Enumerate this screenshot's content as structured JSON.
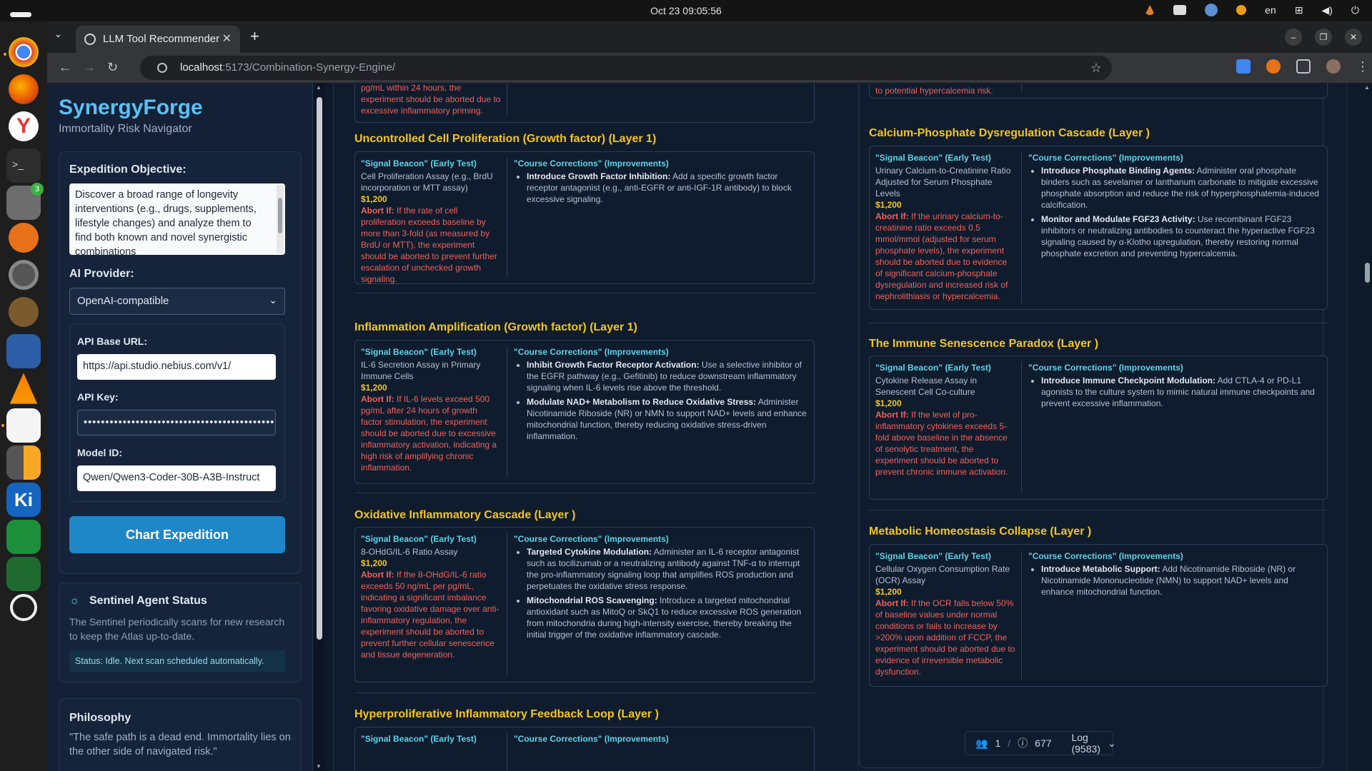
{
  "os": {
    "clock": "Oct 23  09:05:56",
    "lang": "en"
  },
  "dock": {
    "files_badge": "3"
  },
  "browser": {
    "tab_title": "LLM Tool Recommender",
    "url_host": "localhost",
    "url_path": ":5173/Combination-Synergy-Engine/"
  },
  "sidebar": {
    "brand": "SynergyForge",
    "subtitle": "Immortality Risk Navigator",
    "objective_label": "Expedition Objective:",
    "objective_text": "Discover a broad range of longevity interventions (e.g., drugs, supplements, lifestyle changes) and analyze them to find both known and novel synergistic combinations",
    "provider_label": "AI Provider:",
    "provider_value": "OpenAI-compatible",
    "base_url_label": "API Base URL:",
    "base_url_value": "https://api.studio.nebius.com/v1/",
    "api_key_label": "API Key:",
    "api_key_value": "••••••••••••••••••••••••••••••••••••••••••••••••••••••",
    "model_label": "Model ID:",
    "model_value": "Qwen/Qwen3-Coder-30B-A3B-Instruct",
    "cta": "Chart Expedition",
    "sentinel_title": "Sentinel Agent Status",
    "sentinel_desc": "The Sentinel periodically scans for new research to keep the Atlas up-to-date.",
    "sentinel_status": "Status: Idle. Next scan scheduled automatically.",
    "philosophy_title": "Philosophy",
    "philosophy_quote": "\"The safe path is a dead end. Immortality lies on the other side of navigated risk.\""
  },
  "labels": {
    "signal": "\"Signal Beacon\" (Early Test)",
    "course": "\"Course Corrections\" (Improvements)",
    "abort": "Abort If:"
  },
  "left": {
    "top_fragment": "pg/mL within 24 hours, the experiment should be aborted due to excessive inflammatory priming.",
    "cards": [
      {
        "title": "Uncontrolled Cell Proliferation (Growth factor) (Layer 1)",
        "test": "Cell Proliferation Assay (e.g., BrdU incorporation or MTT assay)",
        "price": "$1,200",
        "abort": "If the rate of cell proliferation exceeds baseline by more than 3-fold (as measured by BrdU or MTT), the experiment should be aborted to prevent further escalation of unchecked growth signaling.",
        "corrections": [
          {
            "t": "Introduce Growth Factor Inhibition:",
            "d": " Add a specific growth factor receptor antagonist (e.g., anti-EGFR or anti-IGF-1R antibody) to block excessive signaling."
          }
        ]
      },
      {
        "title": "Inflammation Amplification (Growth factor) (Layer 1)",
        "test": "IL-6 Secretion Assay in Primary Immune Cells",
        "price": "$1,200",
        "abort": "If IL-6 levels exceed 500 pg/mL after 24 hours of growth factor stimulation, the experiment should be aborted due to excessive inflammatory activation, indicating a high risk of amplifying chronic inflammation.",
        "corrections": [
          {
            "t": "Inhibit Growth Factor Receptor Activation:",
            "d": " Use a selective inhibitor of the EGFR pathway (e.g., Gefitinib) to reduce downstream inflammatory signaling when IL-6 levels rise above the threshold."
          },
          {
            "t": "Modulate NAD+ Metabolism to Reduce Oxidative Stress:",
            "d": " Administer Nicotinamide Riboside (NR) or NMN to support NAD+ levels and enhance mitochondrial function, thereby reducing oxidative stress-driven inflammation."
          }
        ]
      },
      {
        "title": "Oxidative Inflammatory Cascade (Layer )",
        "test": "8-OHdG/IL-6 Ratio Assay",
        "price": "$1,200",
        "abort": "If the 8-OHdG/IL-6 ratio exceeds 50 ng/mL per pg/mL, indicating a significant imbalance favoring oxidative damage over anti-inflammatory regulation, the experiment should be aborted to prevent further cellular senescence and tissue degeneration.",
        "corrections": [
          {
            "t": "Targeted Cytokine Modulation:",
            "d": " Administer an IL-6 receptor antagonist such as tocilizumab or a neutralizing antibody against TNF-α to interrupt the pro-inflammatory signaling loop that amplifies ROS production and perpetuates the oxidative stress response."
          },
          {
            "t": "Mitochondrial ROS Scavenging:",
            "d": " Introduce a targeted mitochondrial antioxidant such as MitoQ or SkQ1 to reduce excessive ROS generation from mitochondria during high-intensity exercise, thereby breaking the initial trigger of the oxidative inflammatory cascade."
          }
        ]
      },
      {
        "title": "Hyperproliferative Inflammatory Feedback Loop (Layer )"
      }
    ]
  },
  "right": {
    "top_fragment": "to potential hypercalcemia risk.",
    "cards": [
      {
        "title": "Calcium-Phosphate Dysregulation Cascade (Layer )",
        "test": "Urinary Calcium-to-Creatinine Ratio Adjusted for Serum Phosphate Levels",
        "price": "$1,200",
        "abort": "If the urinary calcium-to-creatinine ratio exceeds 0.5 mmol/mmol (adjusted for serum phosphate levels), the experiment should be aborted due to evidence of significant calcium-phosphate dysregulation and increased risk of nephrolithiasis or hypercalcemia.",
        "corrections": [
          {
            "t": "Introduce Phosphate Binding Agents:",
            "d": " Administer oral phosphate binders such as sevelamer or lanthanum carbonate to mitigate excessive phosphate absorption and reduce the risk of hyperphosphatemia-induced calcification."
          },
          {
            "t": "Monitor and Modulate FGF23 Activity:",
            "d": " Use recombinant FGF23 inhibitors or neutralizing antibodies to counteract the hyperactive FGF23 signaling caused by α-Klotho upregulation, thereby restoring normal phosphate excretion and preventing hypercalcemia."
          }
        ]
      },
      {
        "title": "The Immune Senescence Paradox (Layer )",
        "test": "Cytokine Release Assay in Senescent Cell Co-culture",
        "price": "$1,200",
        "abort": "If the level of pro-inflammatory cytokines exceeds 5-fold above baseline in the absence of senolytic treatment, the experiment should be aborted to prevent chronic immune activation.",
        "corrections": [
          {
            "t": "Introduce Immune Checkpoint Modulation:",
            "d": " Add CTLA-4 or PD-L1 agonists to the culture system to mimic natural immune checkpoints and prevent excessive inflammation."
          }
        ]
      },
      {
        "title": "Metabolic Homeostasis Collapse (Layer )",
        "test": "Cellular Oxygen Consumption Rate (OCR) Assay",
        "price": "$1,200",
        "abort": "If the OCR falls below 50% of baseline values under normal conditions or fails to increase by >200% upon addition of FCCP, the experiment should be aborted due to evidence of irreversible metabolic dysfunction.",
        "corrections": [
          {
            "t": "Introduce Metabolic Support:",
            "d": " Add Nicotinamide Riboside (NR) or Nicotinamide Mononucleotide (NMN) to support NAD+ levels and enhance mitochondrial function."
          }
        ]
      }
    ]
  },
  "footer": {
    "users": "1",
    "issues": "677",
    "log": "Log (9583)"
  }
}
